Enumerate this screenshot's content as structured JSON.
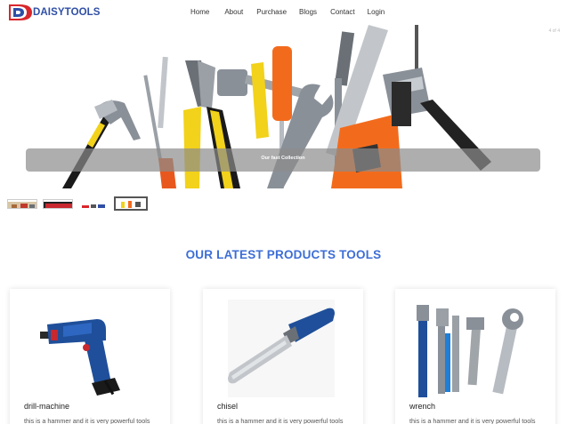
{
  "brand": {
    "name": "DAISYTOOLS",
    "mark": "D"
  },
  "nav": {
    "links": [
      "Home",
      "About",
      "Purchase",
      "Blogs",
      "Contact",
      "Login"
    ]
  },
  "hero": {
    "slide_counter": "4 of 4",
    "caption": "Our fast Collection"
  },
  "section": {
    "title": "OUR LATEST PRODUCTS TOOLS"
  },
  "products": [
    {
      "name": "drill-machine",
      "description": "this is a hammer and it is very powerful tools"
    },
    {
      "name": "chisel",
      "description": "this is a hammer and it is very powerful tools"
    },
    {
      "name": "wrench",
      "description": "this is a hammer and it is very powerful tools"
    }
  ],
  "colors": {
    "brand": "#2f4fa6",
    "accent_red": "#d9262c",
    "section_title": "#3d6ed6",
    "drill_blue": "#1f4f9a",
    "handle_orange": "#f26b1d",
    "handle_yellow": "#f2d21a"
  }
}
